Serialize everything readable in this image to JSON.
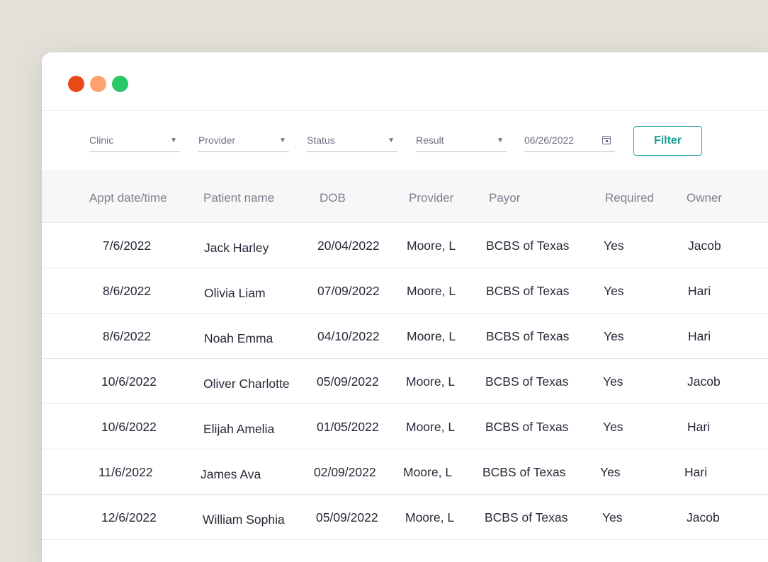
{
  "filters": {
    "clinic": "Clinic",
    "provider": "Provider",
    "status": "Status",
    "result": "Result",
    "date": "06/26/2022",
    "filter_label": "Filter"
  },
  "table": {
    "headers": [
      "Appt date/time",
      "Patient name",
      "DOB",
      "Provider",
      "Payor",
      "Required",
      "Owner"
    ],
    "rows": [
      [
        "7/6/2022",
        "Jack Harley",
        "20/04/2022",
        "Moore, L",
        "BCBS of Texas",
        "Yes",
        "Jacob"
      ],
      [
        "8/6/2022",
        "Olivia Liam",
        "07/09/2022",
        "Moore, L",
        "BCBS of Texas",
        "Yes",
        "Hari"
      ],
      [
        "8/6/2022",
        "Noah Emma",
        "04/10/2022",
        "Moore, L",
        "BCBS of Texas",
        "Yes",
        "Hari"
      ],
      [
        "10/6/2022",
        "Oliver Charlotte",
        "05/09/2022",
        "Moore, L",
        "BCBS of Texas",
        "Yes",
        "Jacob"
      ],
      [
        "10/6/2022",
        "Elijah Amelia",
        "01/05/2022",
        "Moore, L",
        "BCBS of Texas",
        "Yes",
        "Hari"
      ],
      [
        "11/6/2022",
        "James Ava",
        "02/09/2022",
        "Moore, L",
        "BCBS of Texas",
        "Yes",
        "Hari"
      ],
      [
        "12/6/2022",
        "William Sophia",
        "05/09/2022",
        "Moore, L",
        "BCBS of Texas",
        "Yes",
        "Jacob"
      ]
    ]
  },
  "colors": {
    "accent": "#1fa79a",
    "close": "#e64a19",
    "minimize": "#ffa270",
    "maximize": "#2ac769"
  }
}
